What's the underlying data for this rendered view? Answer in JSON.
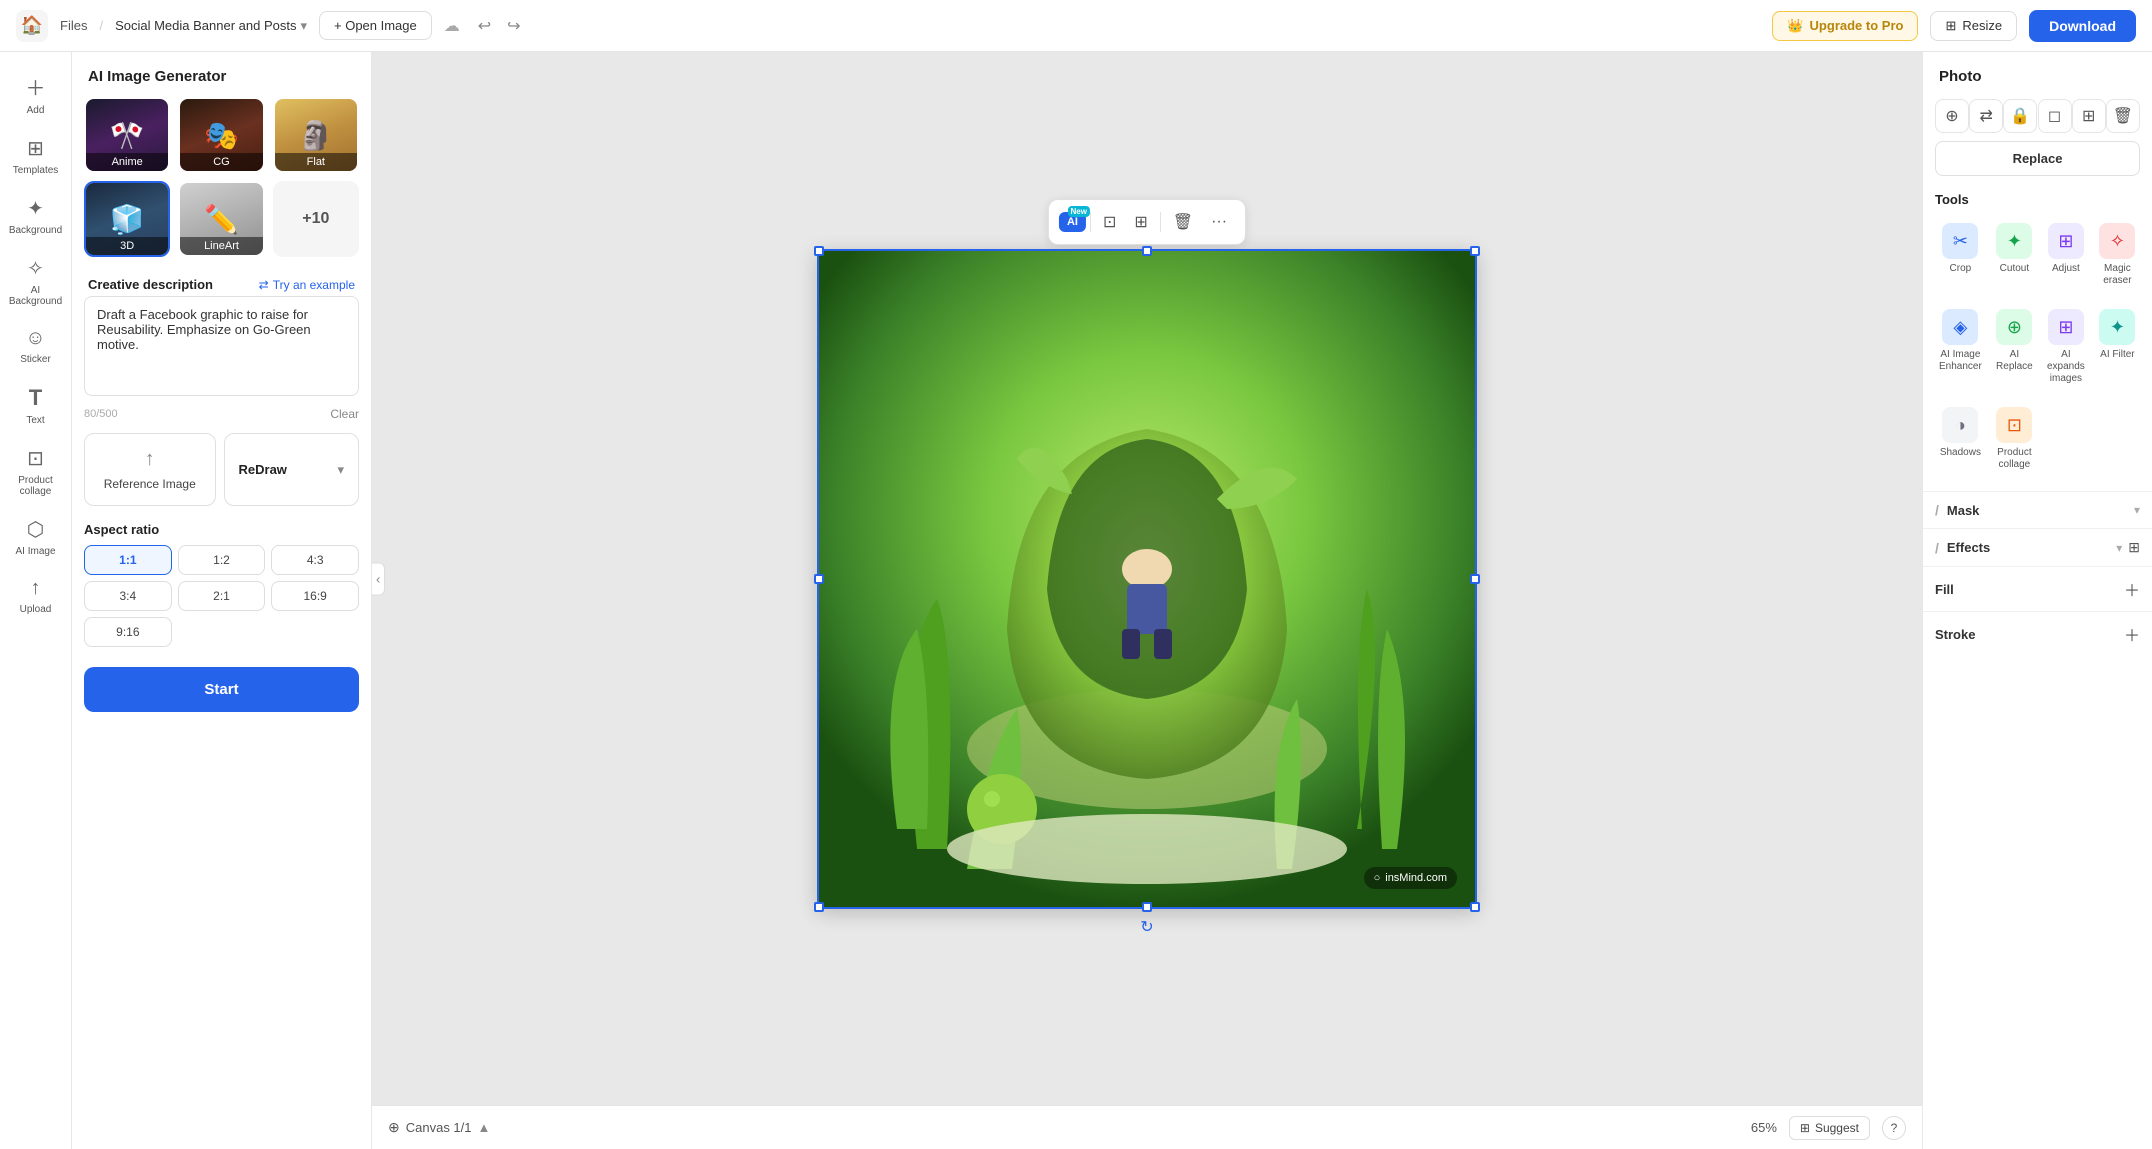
{
  "topbar": {
    "logo_icon": "🏠",
    "files_label": "Files",
    "project_label": "Social Media Banner and Posts",
    "open_image_label": "+ Open Image",
    "upgrade_label": "Upgrade to Pro",
    "resize_label": "Resize",
    "download_label": "Download"
  },
  "sidebar_nav": {
    "items": [
      {
        "id": "add",
        "icon": "＋",
        "label": "Add"
      },
      {
        "id": "templates",
        "icon": "⊞",
        "label": "Templates"
      },
      {
        "id": "background",
        "icon": "✦",
        "label": "Background"
      },
      {
        "id": "ai-background",
        "icon": "✧",
        "label": "AI Background"
      },
      {
        "id": "sticker",
        "icon": "☺",
        "label": "Sticker"
      },
      {
        "id": "text",
        "icon": "T",
        "label": "Text"
      },
      {
        "id": "product-collage",
        "icon": "⊡",
        "label": "Product collage"
      },
      {
        "id": "ai-image",
        "icon": "⬡",
        "label": "AI Image"
      },
      {
        "id": "upload",
        "icon": "↑",
        "label": "Upload"
      }
    ]
  },
  "left_panel": {
    "header": "AI Image Generator",
    "styles": [
      {
        "id": "anime",
        "label": "Anime",
        "active": false
      },
      {
        "id": "cg",
        "label": "CG",
        "active": false
      },
      {
        "id": "flat",
        "label": "Flat",
        "active": false
      },
      {
        "id": "3d",
        "label": "3D",
        "active": true
      },
      {
        "id": "lineart",
        "label": "LineArt",
        "active": false
      }
    ],
    "more_label": "+10",
    "creative_desc_label": "Creative description",
    "try_example_label": "Try an example",
    "textarea_value": "Draft a Facebook graphic to raise for Reusability. Emphasize on Go-Green motive.",
    "char_count": "80/500",
    "clear_label": "Clear",
    "reference_image_label": "Reference Image",
    "redraw_label": "ReDraw",
    "aspect_ratio_label": "Aspect ratio",
    "aspect_options": [
      {
        "value": "1:1",
        "active": true
      },
      {
        "value": "1:2",
        "active": false
      },
      {
        "value": "4:3",
        "active": false
      },
      {
        "value": "3:4",
        "active": false
      },
      {
        "value": "2:1",
        "active": false
      },
      {
        "value": "16:9",
        "active": false
      },
      {
        "value": "9:16",
        "active": false
      }
    ],
    "start_label": "Start"
  },
  "canvas": {
    "watermark": "insMind.com",
    "canvas_label": "Canvas 1/1",
    "zoom_label": "65%",
    "suggest_label": "Suggest",
    "help_label": "?"
  },
  "float_toolbar": {
    "ai_label": "AI",
    "new_badge": "New",
    "icons": [
      "⊡",
      "⊞",
      "🗑",
      "···"
    ]
  },
  "right_panel": {
    "header": "Photo",
    "photo_icons": [
      "⊕",
      "⇄",
      "🔒",
      "◻",
      "⊞",
      "🗑"
    ],
    "replace_label": "Replace",
    "tools_label": "Tools",
    "tools": [
      {
        "id": "crop",
        "icon": "✂",
        "label": "Crop",
        "color_class": "ti-blue"
      },
      {
        "id": "cutout",
        "icon": "✦",
        "label": "Cutout",
        "color_class": "ti-green"
      },
      {
        "id": "adjust",
        "icon": "⊞",
        "label": "Adjust",
        "color_class": "ti-purple"
      },
      {
        "id": "magic-eraser",
        "icon": "✧",
        "label": "Magic eraser",
        "color_class": "ti-red"
      },
      {
        "id": "ai-image-enhancer",
        "icon": "◈",
        "label": "AI Image Enhancer",
        "color_class": "ti-blue"
      },
      {
        "id": "ai-replace",
        "icon": "⊕",
        "label": "AI Replace",
        "color_class": "ti-green"
      },
      {
        "id": "ai-expands-images",
        "icon": "⊞",
        "label": "AI expands images",
        "color_class": "ti-purple"
      },
      {
        "id": "ai-filter",
        "icon": "✦",
        "label": "AI Filter",
        "color_class": "ti-teal"
      },
      {
        "id": "shadows",
        "icon": "◑",
        "label": "Shadows",
        "color_class": "ti-gray"
      },
      {
        "id": "product-collage",
        "icon": "⊡",
        "label": "Product collage",
        "color_class": "ti-orange"
      }
    ],
    "mask_label": "Mask",
    "effects_label": "Effects",
    "fill_label": "Fill",
    "stroke_label": "Stroke"
  }
}
